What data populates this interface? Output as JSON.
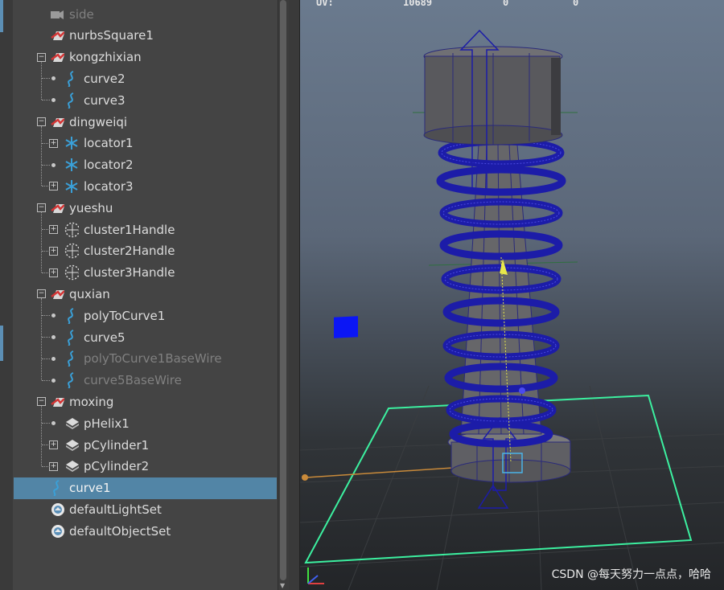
{
  "outliner": {
    "items": [
      {
        "label": "side",
        "icon": "camera-icon",
        "dim": true
      },
      {
        "label": "nurbsSquare1",
        "icon": "group-transform-icon"
      },
      {
        "label": "kongzhixian",
        "icon": "group-transform-icon"
      },
      {
        "label": "curve2",
        "icon": "curve-icon"
      },
      {
        "label": "curve3",
        "icon": "curve-icon"
      },
      {
        "label": "dingweiqi",
        "icon": "group-transform-icon"
      },
      {
        "label": "locator1",
        "icon": "locator-icon"
      },
      {
        "label": "locator2",
        "icon": "locator-icon"
      },
      {
        "label": "locator3",
        "icon": "locator-icon"
      },
      {
        "label": "yueshu",
        "icon": "group-transform-icon"
      },
      {
        "label": "cluster1Handle",
        "icon": "cluster-handle-icon"
      },
      {
        "label": "cluster2Handle",
        "icon": "cluster-handle-icon"
      },
      {
        "label": "cluster3Handle",
        "icon": "cluster-handle-icon"
      },
      {
        "label": "quxian",
        "icon": "group-transform-icon"
      },
      {
        "label": "polyToCurve1",
        "icon": "curve-icon"
      },
      {
        "label": "curve5",
        "icon": "curve-icon"
      },
      {
        "label": "polyToCurve1BaseWire",
        "icon": "curve-icon",
        "dim": true
      },
      {
        "label": "curve5BaseWire",
        "icon": "curve-icon",
        "dim": true
      },
      {
        "label": "moxing",
        "icon": "group-transform-icon"
      },
      {
        "label": "pHelix1",
        "icon": "mesh-icon"
      },
      {
        "label": "pCylinder1",
        "icon": "mesh-icon"
      },
      {
        "label": "pCylinder2",
        "icon": "mesh-icon"
      },
      {
        "label": "curve1",
        "icon": "curve-icon",
        "selected": true
      },
      {
        "label": "defaultLightSet",
        "icon": "set-icon"
      },
      {
        "label": "defaultObjectSet",
        "icon": "set-icon"
      }
    ]
  },
  "viewport": {
    "hud_label": "UV:",
    "hud_values": [
      "10689",
      "0",
      "0"
    ],
    "grid_color": "#3cf0a0",
    "model_color": "#5a5a5e",
    "wire_color": "#2020c0"
  },
  "watermark": "CSDN @每天努力一点点，哈哈"
}
